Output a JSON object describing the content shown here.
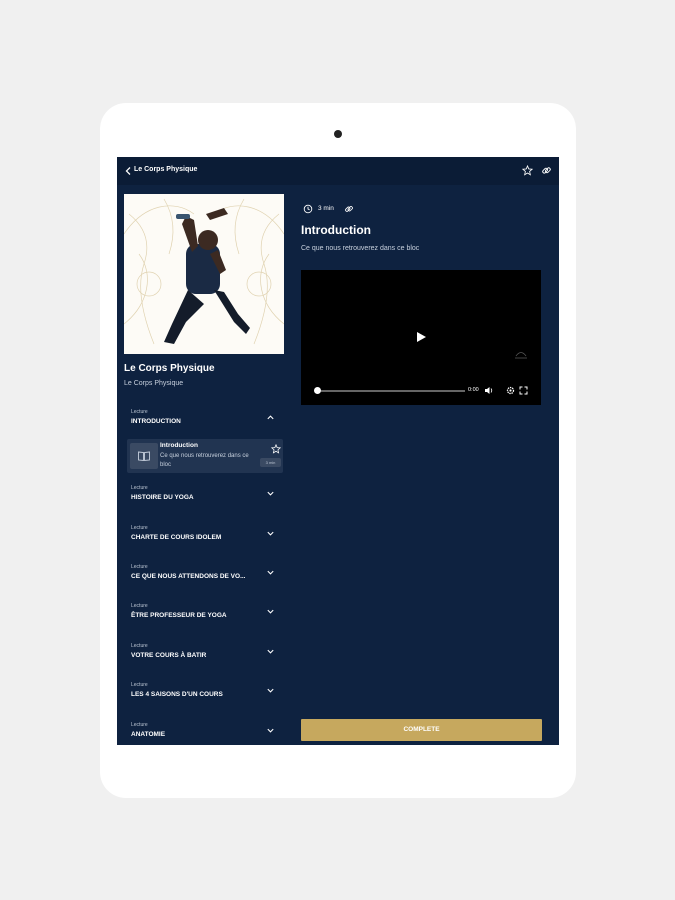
{
  "app": {
    "header_title": "Le Corps Physique"
  },
  "course": {
    "title": "Le Corps Physique",
    "subtitle": "Le Corps Physique"
  },
  "lectures": [
    {
      "type": "Lecture",
      "name": "INTRODUCTION",
      "expanded": true
    },
    {
      "type": "Lecture",
      "name": "HISTOIRE DU YOGA",
      "expanded": false
    },
    {
      "type": "Lecture",
      "name": "CHARTE DE COURS IDOLEM",
      "expanded": false
    },
    {
      "type": "Lecture",
      "name": "CE QUE NOUS ATTENDONS DE VO...",
      "expanded": false
    },
    {
      "type": "Lecture",
      "name": "ÊTRE PROFESSEUR DE YOGA",
      "expanded": false
    },
    {
      "type": "Lecture",
      "name": "VOTRE COURS À BATIR",
      "expanded": false
    },
    {
      "type": "Lecture",
      "name": "LES 4 SAISONS D'UN COURS",
      "expanded": false
    },
    {
      "type": "Lecture",
      "name": "ANATOMIE",
      "expanded": false
    }
  ],
  "sub_item": {
    "title": "Introduction",
    "description": "Ce que nous retrouverez dans ce bloc",
    "badge": "3 min"
  },
  "lesson": {
    "duration": "3 min",
    "title": "Introduction",
    "description": "Ce que nous retrouverez dans ce bloc"
  },
  "video": {
    "time": "0:00",
    "progress": 0
  },
  "complete_label": "COMPLETE",
  "colors": {
    "background": "#0e2240",
    "accent": "#c6a85e"
  },
  "icons": [
    "back-arrow-icon",
    "star-icon",
    "link-icon",
    "chevron-up-icon",
    "chevron-down-icon",
    "book-icon",
    "clock-icon",
    "play-icon",
    "volume-icon",
    "settings-icon",
    "fullscreen-icon"
  ]
}
